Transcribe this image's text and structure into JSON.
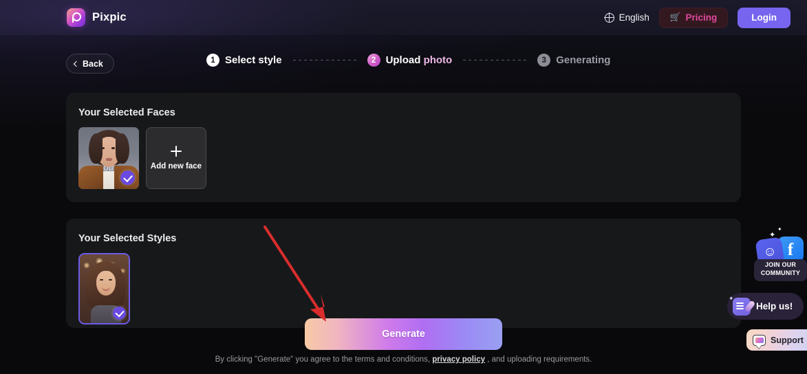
{
  "header": {
    "brand_name": "Pixpic",
    "brand_logo_icon": "pixpic-logo-icon",
    "language": {
      "label": "English",
      "icon": "globe-icon"
    },
    "pricing": {
      "label": "Pricing",
      "icon": "cart-icon"
    },
    "login": {
      "label": "Login"
    }
  },
  "nav": {
    "back_label": "Back",
    "back_icon": "chevron-left-icon"
  },
  "stepper": {
    "steps": [
      {
        "number": "1",
        "label": "Select style",
        "state": "active"
      },
      {
        "number": "2",
        "label_main": "Upload ",
        "label_accent": "photo",
        "state": "current"
      },
      {
        "number": "3",
        "label": "Generating",
        "state": "inactive"
      }
    ]
  },
  "faces_section": {
    "title": "Your Selected Faces",
    "selected_face": {
      "name": "selected-face-thumbnail",
      "checked": true
    },
    "add_new_face_label": "Add new face",
    "add_new_face_icon": "plus-icon"
  },
  "styles_section": {
    "title": "Your Selected Styles",
    "selected_style": {
      "name": "selected-style-thumbnail",
      "checked": true
    }
  },
  "generate": {
    "button_label": "Generate",
    "terms_prefix": "By clicking \"Generate\" you agree to the terms and conditions,",
    "terms_link": "privacy policy",
    "terms_suffix": ", and uploading requirements."
  },
  "widgets": {
    "community": {
      "line1": "JOIN OUR",
      "line2": "COMMUNITY",
      "discord_icon": "discord-icon",
      "facebook_icon": "facebook-icon",
      "facebook_glyph": "f",
      "discord_glyph": "◕",
      "sparkle_glyph": "✦"
    },
    "help": {
      "label": "Help us!",
      "icon": "survey-pen-icon",
      "sparkle_glyph": "✦"
    },
    "support": {
      "label": "Support",
      "icon": "chat-bubble-icon"
    }
  },
  "annotation": {
    "arrow_color": "#d92d2d",
    "arrow_name": "red-pointer-arrow"
  },
  "colors": {
    "page_bg": "#0a0a0d",
    "header_bg": "#161624",
    "card_bg": "#17181a",
    "login_purple": "#7765f0",
    "pricing_pink": "#e0489f",
    "pricing_bg": "#33191f",
    "cart_orange": "#e8803a",
    "check_badge_purple": "#6a4ae0",
    "style_border_purple": "#6c5ce7"
  }
}
